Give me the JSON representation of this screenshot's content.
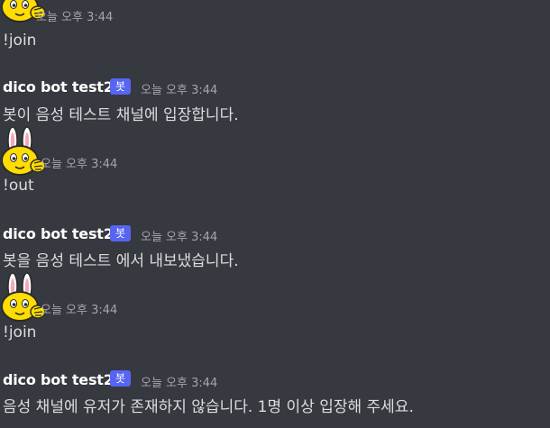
{
  "messages": [
    {
      "type": "user",
      "timestamp": "오늘 오후 3:44",
      "content": "!join"
    },
    {
      "type": "bot",
      "username": "dico bot test2",
      "badge": "봇",
      "timestamp": "오늘 오후 3:44",
      "content": "봇이 음성 테스트 채널에 입장합니다."
    },
    {
      "type": "user",
      "timestamp": "오늘 오후 3:44",
      "content": "!out"
    },
    {
      "type": "bot",
      "username": "dico bot test2",
      "badge": "봇",
      "timestamp": "오늘 오후 3:44",
      "content": "봇을 음성 테스트 에서 내보냈습니다."
    },
    {
      "type": "user",
      "timestamp": "오늘 오후 3:44",
      "content": "!join"
    },
    {
      "type": "bot",
      "username": "dico bot test2",
      "badge": "봇",
      "timestamp": "오늘 오후 3:44",
      "content": "음성 채널에 유저가 존재하지 않습니다. 1명 이상 입장해 주세요."
    }
  ],
  "colors": {
    "background": "#36393f",
    "text": "#dcddde",
    "username": "#ffffff",
    "timestamp": "#a3a6aa",
    "bot_badge": "#5865f2"
  },
  "icons": {
    "user_avatar": "yellow-bunny-avatar-icon"
  }
}
